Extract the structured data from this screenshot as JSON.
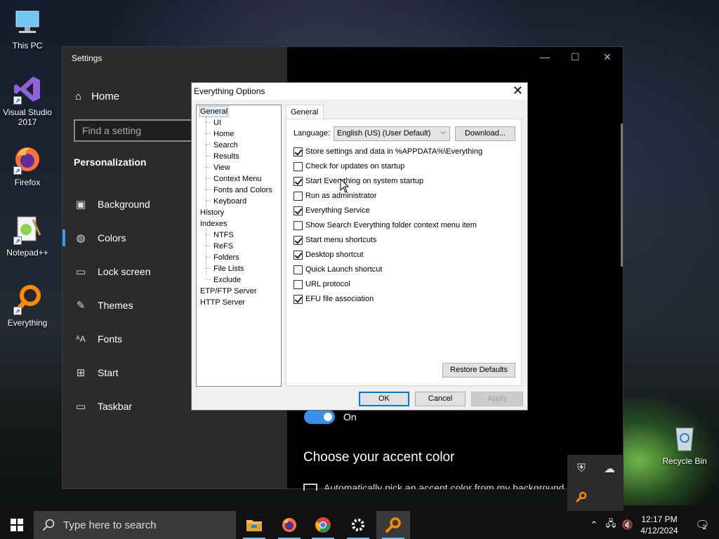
{
  "desktop": {
    "icons": [
      {
        "label": "This PC"
      },
      {
        "label": "Visual Studio 2017"
      },
      {
        "label": "Firefox"
      },
      {
        "label": "Notepad++"
      },
      {
        "label": "Everything"
      },
      {
        "label": "Recycle Bin"
      }
    ]
  },
  "settings": {
    "title": "Settings",
    "home_label": "Home",
    "search_placeholder": "Find a setting",
    "section_title": "Personalization",
    "nav": [
      {
        "label": "Background",
        "icon": "picture-icon"
      },
      {
        "label": "Colors",
        "icon": "palette-icon"
      },
      {
        "label": "Lock screen",
        "icon": "lock-screen-icon"
      },
      {
        "label": "Themes",
        "icon": "themes-icon"
      },
      {
        "label": "Fonts",
        "icon": "fonts-icon"
      },
      {
        "label": "Start",
        "icon": "start-icon"
      },
      {
        "label": "Taskbar",
        "icon": "taskbar-icon"
      }
    ],
    "active_nav": "Colors",
    "toggle_label": "On",
    "accent_title": "Choose your accent color",
    "accent_checkbox_text": "Automatically pick an accent color from my background",
    "accent_color": "#2f9bff"
  },
  "dialog": {
    "title": "Everything Options",
    "tree": {
      "general": "General",
      "general_children": [
        "UI",
        "Home",
        "Search",
        "Results",
        "View",
        "Context Menu",
        "Fonts and Colors",
        "Keyboard"
      ],
      "history": "History",
      "indexes": "Indexes",
      "indexes_children": [
        "NTFS",
        "ReFS",
        "Folders",
        "File Lists",
        "Exclude"
      ],
      "etp": "ETP/FTP Server",
      "http": "HTTP Server"
    },
    "tab_label": "General",
    "language_label": "Language:",
    "language_value": "English (US) (User Default)",
    "download_label": "Download...",
    "options": [
      {
        "label": "Store settings and data in %APPDATA%\\Everything",
        "checked": true
      },
      {
        "label": "Check for updates on startup",
        "checked": false
      },
      {
        "label": "Start Everything on system startup",
        "checked": true
      },
      {
        "label": "Run as administrator",
        "checked": false
      },
      {
        "label": "Everything Service",
        "checked": true
      },
      {
        "label": "Show Search Everything folder context menu item",
        "checked": false
      },
      {
        "label": "Start menu shortcuts",
        "checked": true
      },
      {
        "label": "Desktop shortcut",
        "checked": true
      },
      {
        "label": "Quick Launch shortcut",
        "checked": false
      },
      {
        "label": "URL protocol",
        "checked": false
      },
      {
        "label": "EFU file association",
        "checked": true
      }
    ],
    "restore_label": "Restore Defaults",
    "ok_label": "OK",
    "cancel_label": "Cancel",
    "apply_label": "Apply"
  },
  "taskbar": {
    "search_placeholder": "Type here to search",
    "apps": [
      "file-explorer-icon",
      "firefox-icon",
      "chrome-icon",
      "settings-gear-icon",
      "everything-icon"
    ],
    "time": "12:17 PM",
    "date": "4/12/2024",
    "notification_count": "2"
  }
}
